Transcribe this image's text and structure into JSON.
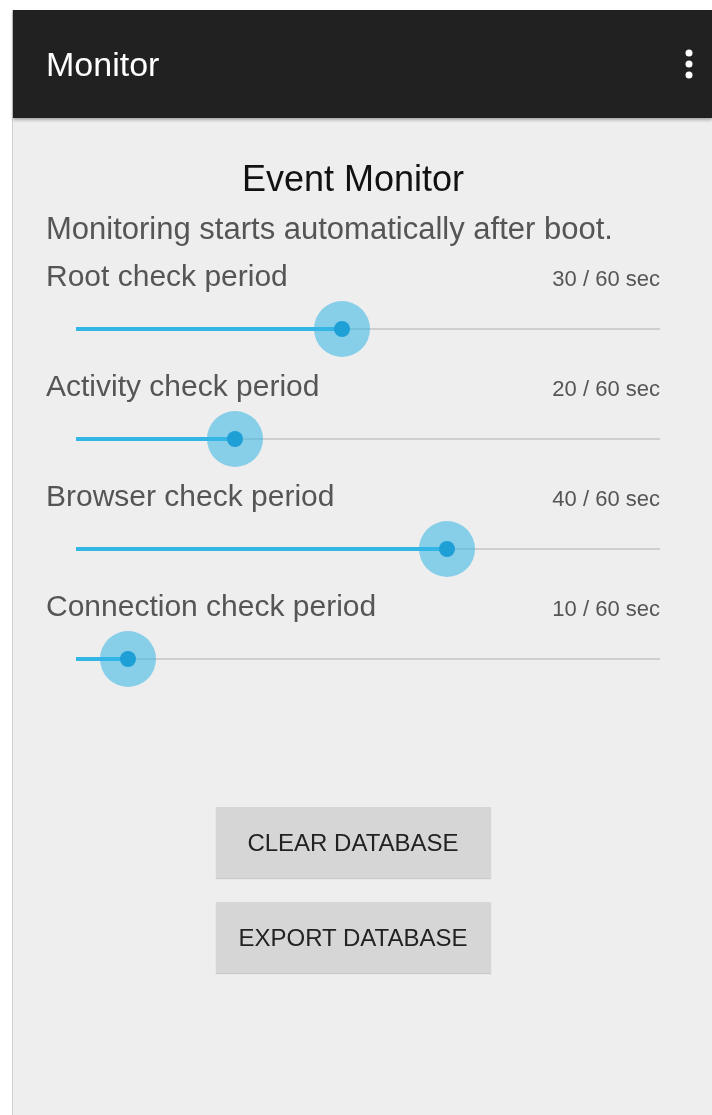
{
  "action_bar": {
    "title": "Monitor"
  },
  "heading": "Event Monitor",
  "description": "Monitoring starts automatically after boot.",
  "sliders": [
    {
      "label": "Root check period",
      "reading": "30 / 60 sec",
      "level": 0.455
    },
    {
      "label": "Activity check period",
      "reading": "20 / 60 sec",
      "level": 0.272
    },
    {
      "label": "Browser check period",
      "reading": "40 / 60 sec",
      "level": 0.635
    },
    {
      "label": "Connection check period",
      "reading": "10 / 60 sec",
      "level": 0.089
    }
  ],
  "buttons": [
    "CLEAR DATABASE",
    "EXPORT DATABASE"
  ]
}
